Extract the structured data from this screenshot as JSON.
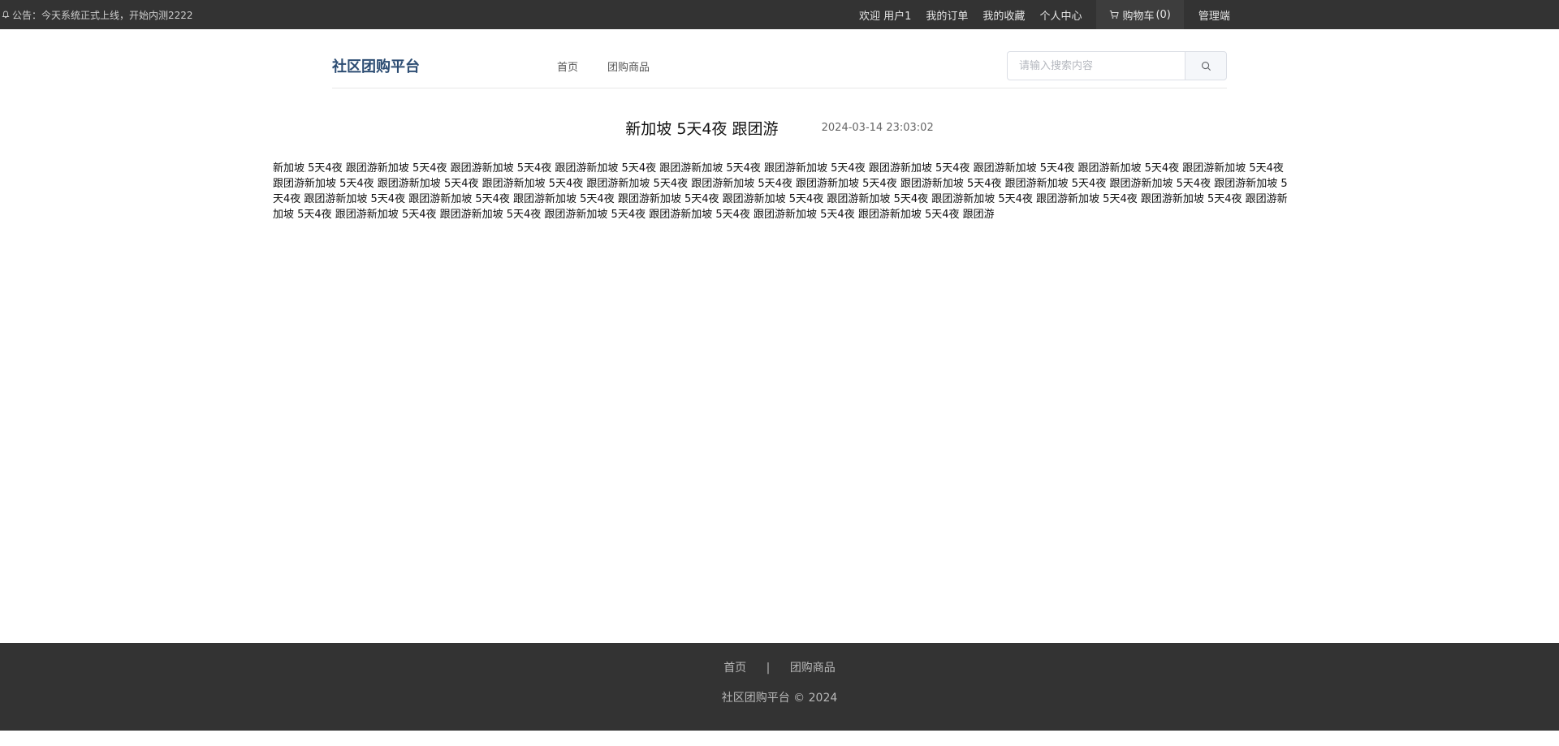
{
  "topbar": {
    "notice": "公告：今天系统正式上线，开始内测2222",
    "welcome": "欢迎 用户1",
    "orders": "我的订单",
    "favorites": "我的收藏",
    "profile": "个人中心",
    "cart_label": "购物车",
    "cart_count": "(0)",
    "admin": "管理端",
    "icons": {
      "notice": "bell-icon",
      "cart": "cart-icon"
    }
  },
  "header": {
    "logo": "社区团购平台",
    "nav": [
      "首页",
      "团购商品"
    ],
    "search_placeholder": "请输入搜索内容",
    "search_icon": "search-icon"
  },
  "article": {
    "title": "新加坡 5天4夜 跟团游",
    "date": "2024-03-14 23:03:02",
    "body": "新加坡 5天4夜 跟团游新加坡 5天4夜 跟团游新加坡 5天4夜 跟团游新加坡 5天4夜 跟团游新加坡 5天4夜 跟团游新加坡 5天4夜 跟团游新加坡 5天4夜 跟团游新加坡 5天4夜 跟团游新加坡 5天4夜 跟团游新加坡 5天4夜 跟团游新加坡 5天4夜 跟团游新加坡 5天4夜 跟团游新加坡 5天4夜 跟团游新加坡 5天4夜 跟团游新加坡 5天4夜 跟团游新加坡 5天4夜 跟团游新加坡 5天4夜 跟团游新加坡 5天4夜 跟团游新加坡 5天4夜 跟团游新加坡 5天4夜 跟团游新加坡 5天4夜 跟团游新加坡 5天4夜 跟团游新加坡 5天4夜 跟团游新加坡 5天4夜 跟团游新加坡 5天4夜 跟团游新加坡 5天4夜 跟团游新加坡 5天4夜 跟团游新加坡 5天4夜 跟团游新加坡 5天4夜 跟团游新加坡 5天4夜 跟团游新加坡 5天4夜 跟团游新加坡 5天4夜 跟团游新加坡 5天4夜 跟团游新加坡 5天4夜 跟团游新加坡 5天4夜 跟团游新加坡 5天4夜 跟团游"
  },
  "footer": {
    "links": [
      "首页",
      "团购商品"
    ],
    "separator": "|",
    "copyright": "社区团购平台 © 2024"
  },
  "colors": {
    "topbar_bg": "#333333",
    "footer_bg": "#333333",
    "logo": "#2d4d73"
  }
}
